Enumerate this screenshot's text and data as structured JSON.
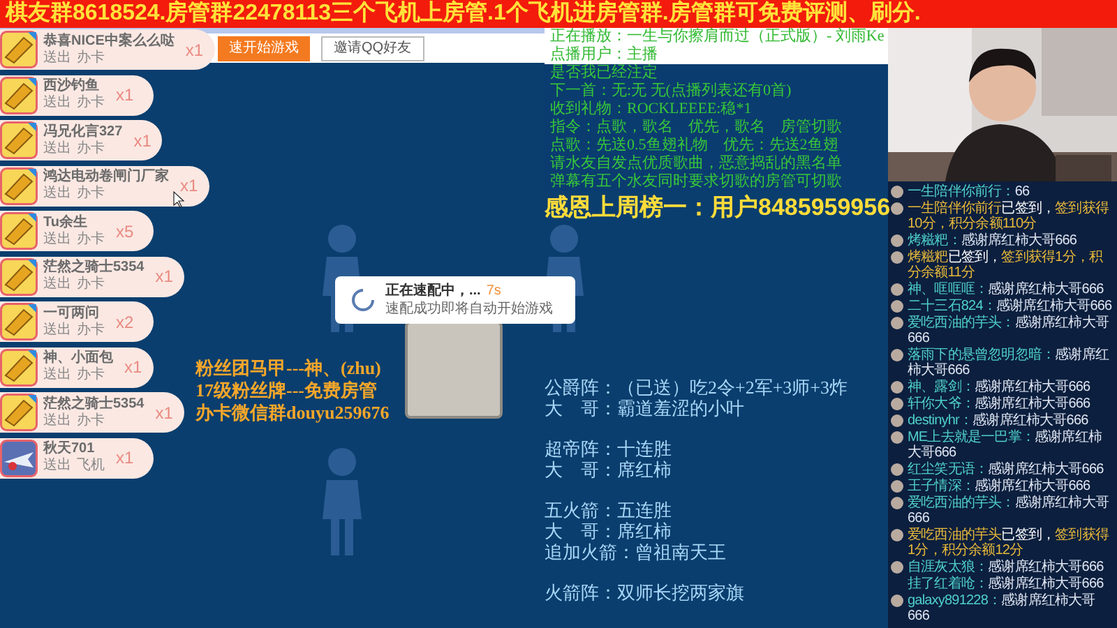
{
  "banner": {
    "text": "棋友群8618524.房管群22478113三个飞机上房管.1个飞机进房管群.房管群可免费评测、刷分."
  },
  "game": {
    "buttons": [
      {
        "label": "速开始游戏",
        "kind": "primary"
      },
      {
        "label": "邀请QQ好友",
        "kind": "secondary"
      }
    ],
    "matching_dialog": {
      "title": "正在速配中，...",
      "timer": "7s",
      "message": "速配成功即将自动开始游戏"
    }
  },
  "gifts": [
    {
      "name": "恭喜NICE中案么么哒",
      "action": "送出",
      "gift": "办卡",
      "count": "x1",
      "kind": "card"
    },
    {
      "name": "西沙钓鱼",
      "action": "送出",
      "gift": "办卡",
      "count": "x1",
      "kind": "card"
    },
    {
      "name": "冯兄化言327",
      "action": "送出",
      "gift": "办卡",
      "count": "x1",
      "kind": "card"
    },
    {
      "name": "鸿达电动卷闸门厂家",
      "action": "送出",
      "gift": "办卡",
      "count": "x1",
      "kind": "card"
    },
    {
      "name": "Tu余生",
      "action": "送出",
      "gift": "办卡",
      "count": "x5",
      "kind": "card"
    },
    {
      "name": "茫然之骑士5354",
      "action": "送出",
      "gift": "办卡",
      "count": "x1",
      "kind": "card"
    },
    {
      "name": "一可两问",
      "action": "送出",
      "gift": "办卡",
      "count": "x2",
      "kind": "card"
    },
    {
      "name": "神、小面包",
      "action": "送出",
      "gift": "办卡",
      "count": "x1",
      "kind": "card"
    },
    {
      "name": "茫然之骑士5354",
      "action": "送出",
      "gift": "办卡",
      "count": "x1",
      "kind": "card"
    },
    {
      "name": "秋天701",
      "action": "送出",
      "gift": "飞机",
      "count": "x1",
      "kind": "plane"
    }
  ],
  "fan_notes": [
    "粉丝团马甲---神、(zhu)",
    "17级粉丝牌---免费房管",
    "办卡微信群douyu259676"
  ],
  "song_panel": {
    "header": [
      "正在播放：一生与你擦肩而过（正式版）- 刘雨Ke",
      "点播用户：主播"
    ],
    "lines": [
      "是否我已经注定",
      "下一首：无:无 无(点播列表还有0首)",
      "收到礼物：ROCKLEEEE:稳*1",
      "指令：点歌，歌名　优先，歌名　房管切歌",
      "点歌：先送0.5鱼翅礼物　优先：先送2鱼翅",
      "请水友自发点优质歌曲，恶意捣乱的黑名单",
      "弹幕有五个水友同时要求切歌的房管可切歌"
    ]
  },
  "thanks": "感恩上周榜一：用户8485959956",
  "ranking_sections": [
    [
      "公爵阵：（已送）吃2令+2军+3师+3炸",
      "大　哥：霸道羞涩的小叶"
    ],
    [
      "超帝阵：十连胜",
      "大　哥：席红柿"
    ],
    [
      "五火箭：五连胜",
      "大　哥：席红柿",
      "追加火箭：曾祖南天王"
    ],
    [
      "火箭阵：双师长挖两家旗"
    ]
  ],
  "chat": [
    {
      "kind": "chat",
      "avatar": true,
      "name": "一生陪伴你前行：",
      "text": "66"
    },
    {
      "kind": "signin",
      "avatar": true,
      "name": "一生陪伴你前行",
      "note": "已签到，",
      "text": "签到获得10分，积分余额110分"
    },
    {
      "kind": "chat",
      "avatar": true,
      "name": "烤糍粑：",
      "text": "感谢席红柿大哥666"
    },
    {
      "kind": "signin",
      "avatar": true,
      "name": "烤糍粑",
      "note": "已签到，",
      "text": "签到获得1分，积分余额11分"
    },
    {
      "kind": "chat",
      "avatar": true,
      "name": "神、哐哐哐：",
      "text": "感谢席红柿大哥666"
    },
    {
      "kind": "chat",
      "avatar": true,
      "name": "二十三石824：",
      "text": "感谢席红柿大哥666"
    },
    {
      "kind": "chat",
      "avatar": true,
      "name": "爱吃西油的芋头：",
      "text": "感谢席红柿大哥666"
    },
    {
      "kind": "chat",
      "avatar": true,
      "name": "落雨下的悬曾忽明忽暗：",
      "text": "感谢席红柿大哥666"
    },
    {
      "kind": "chat",
      "avatar": true,
      "name": "神、露剑：",
      "text": "感谢席红柿大哥666"
    },
    {
      "kind": "chat",
      "avatar": true,
      "name": "轩你大爷：",
      "text": "感谢席红柿大哥666"
    },
    {
      "kind": "chat",
      "avatar": true,
      "name": "destinyhr：",
      "text": "感谢席红柿大哥666"
    },
    {
      "kind": "chat",
      "avatar": true,
      "name": "ME上去就是一巴掌：",
      "text": "感谢席红柿大哥666"
    },
    {
      "kind": "chat",
      "avatar": true,
      "name": "红尘笑无语：",
      "text": "感谢席红柿大哥666"
    },
    {
      "kind": "chat",
      "avatar": true,
      "name": "王子情深：",
      "text": "感谢席红柿大哥666"
    },
    {
      "kind": "chat",
      "avatar": true,
      "name": "爱吃西油的芋头：",
      "text": "感谢席红柿大哥666"
    },
    {
      "kind": "signin",
      "avatar": true,
      "name": "爱吃西油的芋头",
      "note": "已签到，",
      "text": "签到获得1分，积分余额12分"
    },
    {
      "kind": "chat",
      "avatar": true,
      "name": "自涯灰太狼：",
      "text": "感谢席红柿大哥666"
    },
    {
      "kind": "chat",
      "avatar": false,
      "name": "挂了红着呛：",
      "text": "感谢席红柿大哥666"
    },
    {
      "kind": "chat",
      "avatar": true,
      "name": "galaxy891228：",
      "text": "感谢席红柿大哥666"
    }
  ]
}
